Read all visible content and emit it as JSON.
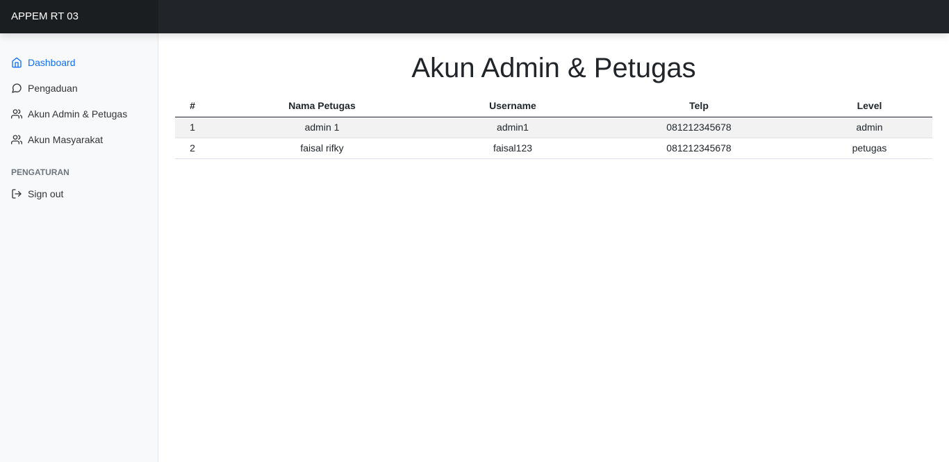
{
  "brand": "APPEM RT 03",
  "sidebar": {
    "items": [
      {
        "label": "Dashboard",
        "icon": "home-icon",
        "active": true
      },
      {
        "label": "Pengaduan",
        "icon": "message-circle-icon"
      },
      {
        "label": "Akun Admin & Petugas",
        "icon": "users-icon"
      },
      {
        "label": "Akun Masyarakat",
        "icon": "users-icon"
      }
    ],
    "section_heading": "PENGATURAN",
    "settings_items": [
      {
        "label": "Sign out",
        "icon": "log-out-icon"
      }
    ]
  },
  "main": {
    "title": "Akun Admin & Petugas",
    "table": {
      "headers": [
        "#",
        "Nama Petugas",
        "Username",
        "Telp",
        "Level"
      ],
      "rows": [
        [
          "1",
          "admin 1",
          "admin1",
          "081212345678",
          "admin"
        ],
        [
          "2",
          "faisal rifky",
          "faisal123",
          "081212345678",
          "petugas"
        ]
      ]
    }
  },
  "colors": {
    "navbar": "#212529",
    "brand_bg": "#1b1e21",
    "sidebar_bg": "#f8f9fa",
    "active_link": "#0d6efd",
    "row_stripe": "#f2f2f2"
  }
}
